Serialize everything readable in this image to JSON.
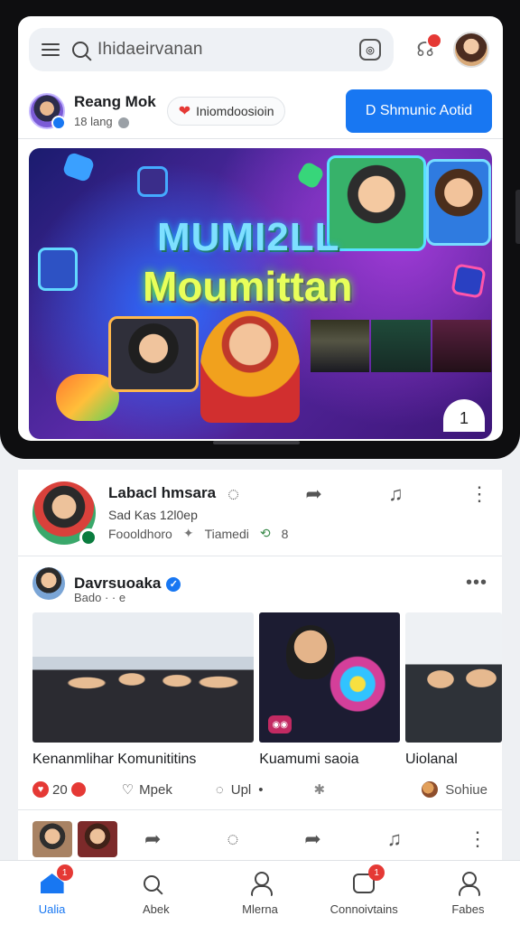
{
  "top": {
    "search_placeholder": "Ihidaeirvanan",
    "camera_icon": "camera-icon",
    "notification_icon": "notification-icon",
    "avatar": "profile-avatar"
  },
  "profile": {
    "name": "Reang Mok",
    "subtitle": "18 lang",
    "chip_text": "Iniomdoosioin",
    "button_label": "D Shmunic Aotid",
    "accent": "#1877f2"
  },
  "banner": {
    "title_line1": "MUMI2LL",
    "title_line2": "Moumittan",
    "page_indicator": "1"
  },
  "feed": {
    "post_a": {
      "name": "Labacl hmsara",
      "line2": "Sad Kas 12l0ep",
      "line3_left": "Foooldhoro",
      "line3_mid": "Tiamedi",
      "line3_right": "8"
    },
    "post_b": {
      "name": "Davrsuoaka",
      "subtitle": "Bado · · e",
      "captions": [
        "Kenanmlihar Komunititins",
        "Kuamumi saoia",
        "Uiolanal"
      ],
      "reactions": {
        "count": "20",
        "like_label": "Mpek",
        "comment_label": "Upl",
        "last_label": "Sohiue"
      }
    }
  },
  "nav": {
    "items": [
      {
        "label": "Ualia",
        "icon": "home-icon",
        "badge": "1"
      },
      {
        "label": "Abek",
        "icon": "search-icon",
        "badge": ""
      },
      {
        "label": "Mlerna",
        "icon": "people-icon",
        "badge": ""
      },
      {
        "label": "Connoivtains",
        "icon": "message-icon",
        "badge": "1"
      },
      {
        "label": "Fabes",
        "icon": "profile-icon",
        "badge": ""
      }
    ]
  }
}
